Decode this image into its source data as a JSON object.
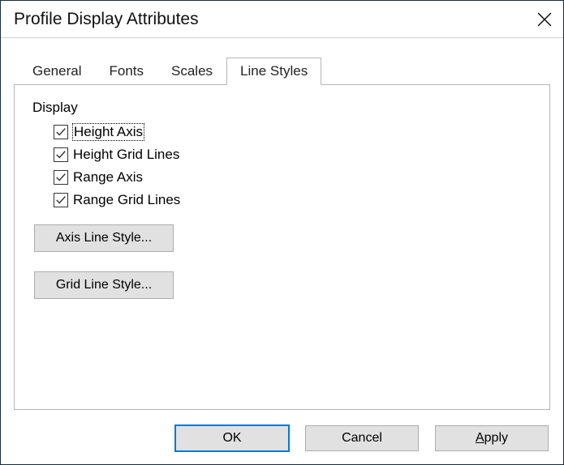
{
  "title": "Profile Display Attributes",
  "tabs": {
    "general": "General",
    "fonts": "Fonts",
    "scales": "Scales",
    "line_styles": "Line Styles"
  },
  "panel": {
    "group_label": "Display",
    "checks": {
      "height_axis": "Height Axis",
      "height_grid": "Height Grid Lines",
      "range_axis": "Range Axis",
      "range_grid": "Range Grid Lines"
    },
    "axis_btn": "Axis Line Style...",
    "grid_btn": "Grid Line Style..."
  },
  "buttons": {
    "ok": "OK",
    "cancel": "Cancel",
    "apply_prefix": "A",
    "apply_rest": "pply"
  }
}
